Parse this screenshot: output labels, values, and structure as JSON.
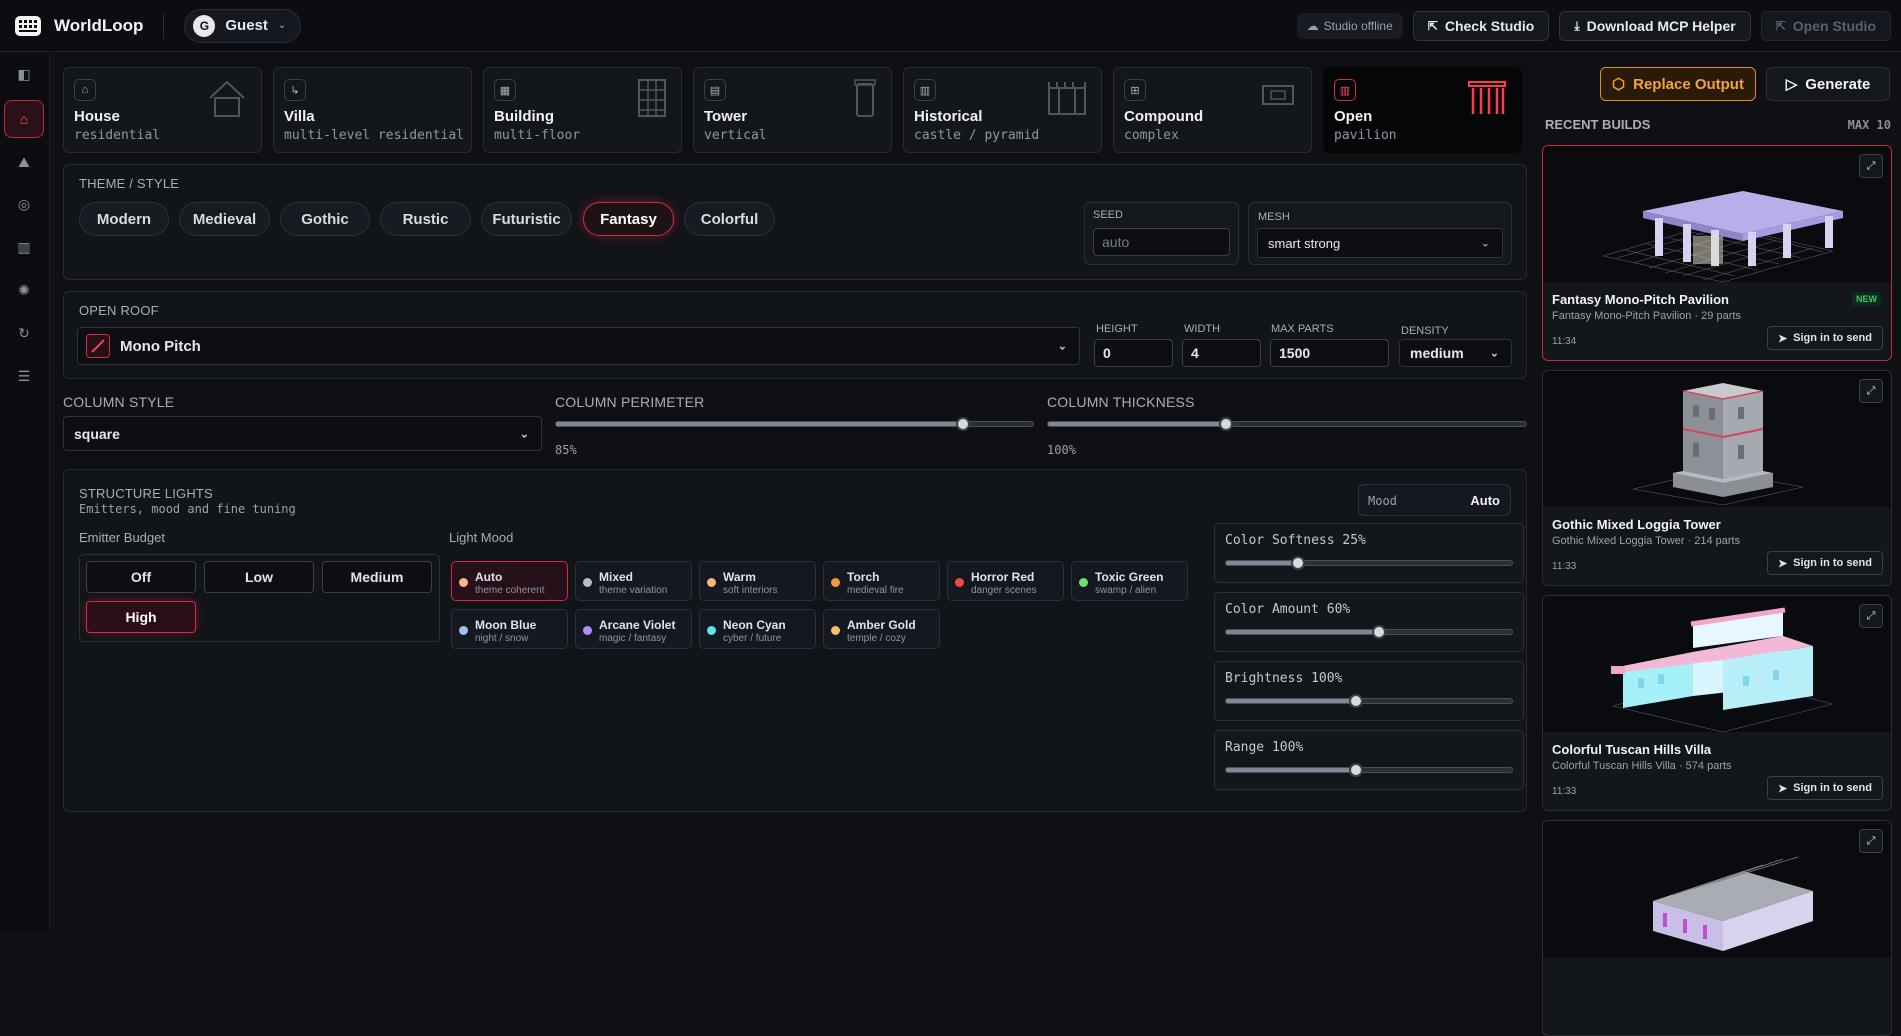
{
  "app": {
    "title": "WorldLoop"
  },
  "user": {
    "initial": "G",
    "name": "Guest"
  },
  "topbar": {
    "status": "Studio offline",
    "check_studio": "Check Studio",
    "download_helper": "Download MCP Helper",
    "open_studio": "Open Studio"
  },
  "types": [
    {
      "name": "House",
      "sub": "residential"
    },
    {
      "name": "Villa",
      "sub": "multi-level residential"
    },
    {
      "name": "Building",
      "sub": "multi-floor"
    },
    {
      "name": "Tower",
      "sub": "vertical"
    },
    {
      "name": "Historical",
      "sub": "castle / pyramid"
    },
    {
      "name": "Compound",
      "sub": "complex"
    },
    {
      "name": "Open",
      "sub": "pavilion"
    }
  ],
  "theme": {
    "label": "THEME / STYLE",
    "options": [
      "Modern",
      "Medieval",
      "Gothic",
      "Rustic",
      "Futuristic",
      "Fantasy",
      "Colorful"
    ],
    "selected": "Fantasy"
  },
  "seed": {
    "label": "SEED",
    "placeholder": "auto"
  },
  "mesh": {
    "label": "MESH",
    "value": "smart strong"
  },
  "roof": {
    "label": "OPEN ROOF",
    "value": "Mono Pitch"
  },
  "params": {
    "height": {
      "label": "HEIGHT",
      "value": "0"
    },
    "width": {
      "label": "WIDTH",
      "value": "4"
    },
    "max_parts": {
      "label": "MAX PARTS",
      "value": "1500"
    },
    "density": {
      "label": "DENSITY",
      "value": "medium"
    }
  },
  "columns": {
    "style_label": "COLUMN STYLE",
    "style_value": "square",
    "perimeter_label": "COLUMN PERIMETER",
    "perimeter_value": "85%",
    "perimeter_level": 0.85,
    "thickness_label": "COLUMN THICKNESS",
    "thickness_value": "100%",
    "thickness_level": 0.37
  },
  "lights": {
    "title": "STRUCTURE LIGHTS",
    "subtitle": "Emitters, mood and fine tuning",
    "mood_label": "Mood",
    "mood_value": "Auto",
    "budget_label": "Emitter Budget",
    "budget_options": [
      "Off",
      "Low",
      "Medium",
      "High"
    ],
    "budget_selected": "High",
    "light_mood_label": "Light Mood",
    "moods": [
      {
        "name": "Auto",
        "sub": "theme coherent",
        "color": "#f5b88a"
      },
      {
        "name": "Mixed",
        "sub": "theme variation",
        "color": "#b9bcc3"
      },
      {
        "name": "Warm",
        "sub": "soft interiors",
        "color": "#f3b77c"
      },
      {
        "name": "Torch",
        "sub": "medieval fire",
        "color": "#f29a3e"
      },
      {
        "name": "Horror Red",
        "sub": "danger scenes",
        "color": "#f04848"
      },
      {
        "name": "Toxic Green",
        "sub": "swamp / alien",
        "color": "#6ee06e"
      },
      {
        "name": "Moon Blue",
        "sub": "night / snow",
        "color": "#9cc3f2"
      },
      {
        "name": "Arcane Violet",
        "sub": "magic / fantasy",
        "color": "#b58cf2"
      },
      {
        "name": "Neon Cyan",
        "sub": "cyber / future",
        "color": "#5fe3ec"
      },
      {
        "name": "Amber Gold",
        "sub": "temple / cozy",
        "color": "#f3c16a"
      }
    ],
    "mood_selected": "Auto",
    "tuning": [
      {
        "label": "Color Softness 25%",
        "level": 0.25
      },
      {
        "label": "Color Amount 60%",
        "level": 0.53
      },
      {
        "label": "Brightness 100%",
        "level": 0.45
      },
      {
        "label": "Range 100%",
        "level": 0.45
      }
    ]
  },
  "actions": {
    "replace_output": "Replace Output",
    "generate": "Generate"
  },
  "recent": {
    "title": "RECENT BUILDS",
    "max": "MAX 10",
    "items": [
      {
        "title": "Fantasy Mono-Pitch Pavilion",
        "sub": "Fantasy Mono-Pitch Pavilion · 29 parts",
        "time": "11:34",
        "badge": "NEW",
        "send": "Sign in to send"
      },
      {
        "title": "Gothic Mixed Loggia Tower",
        "sub": "Gothic Mixed Loggia Tower · 214 parts",
        "time": "11:33",
        "badge": "",
        "send": "Sign in to send"
      },
      {
        "title": "Colorful Tuscan Hills Villa",
        "sub": "Colorful Tuscan Hills Villa · 574 parts",
        "time": "11:33",
        "badge": "",
        "send": "Sign in to send"
      },
      {
        "title": "",
        "sub": "",
        "time": "",
        "badge": "",
        "send": ""
      }
    ]
  },
  "colors": {
    "accent": "#d42a45",
    "generate_border": "#2a2e37",
    "replace_border": "#e08a2a",
    "new_badge": "#2ecc71"
  }
}
